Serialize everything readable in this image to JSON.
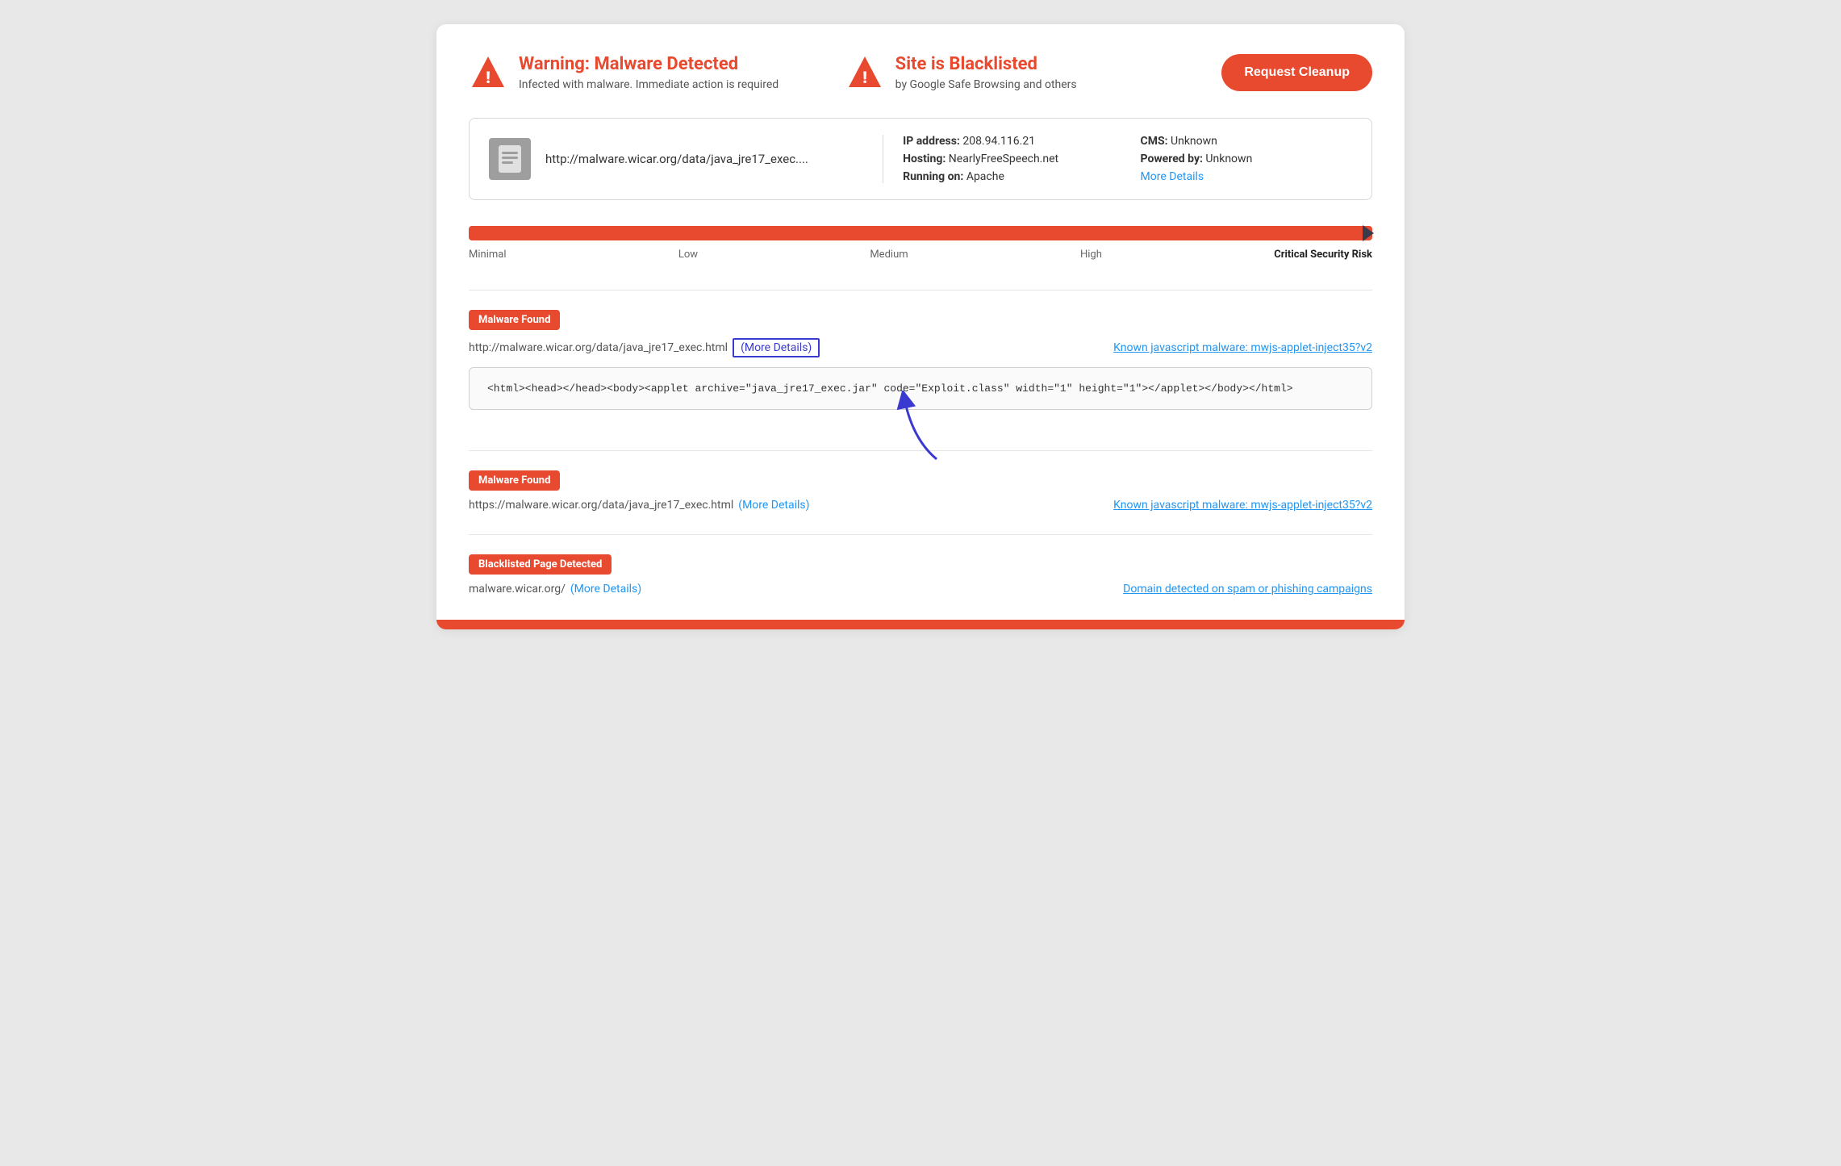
{
  "header": {
    "warning1": {
      "title": "Warning: Malware Detected",
      "subtitle": "Infected with malware. Immediate action is required"
    },
    "warning2": {
      "title": "Site is Blacklisted",
      "subtitle": "by Google Safe Browsing and others"
    },
    "cleanup_button": "Request Cleanup"
  },
  "site_info": {
    "url": "http://malware.wicar.org/data/java_jre17_exec....",
    "ip_label": "IP address:",
    "ip_value": "208.94.116.21",
    "hosting_label": "Hosting:",
    "hosting_value": "NearlyFreeSpeech.net",
    "running_label": "Running on:",
    "running_value": "Apache",
    "cms_label": "CMS:",
    "cms_value": "Unknown",
    "powered_label": "Powered by:",
    "powered_value": "Unknown",
    "more_details": "More Details"
  },
  "risk_bar": {
    "labels": [
      "Minimal",
      "Low",
      "Medium",
      "High",
      "Critical Security Risk"
    ]
  },
  "malware_entries": [
    {
      "badge": "Malware Found",
      "url": "http://malware.wicar.org/data/java_jre17_exec.html",
      "more_details_text": "(More Details)",
      "known_malware_text": "Known javascript malware: mwjs-applet-inject35?v2",
      "code": "<html><head></head><body><applet archive=\"java_jre17_exec.jar\" code=\"Exploit.class\" width=\"1\" height=\"1\"></applet></body></html>",
      "has_arrow": true
    },
    {
      "badge": "Malware Found",
      "url": "https://malware.wicar.org/data/java_jre17_exec.html",
      "more_details_text": "(More Details)",
      "known_malware_text": "Known javascript malware: mwjs-applet-inject35?v2",
      "code": null,
      "has_arrow": false
    }
  ],
  "blacklisted_entry": {
    "badge": "Blacklisted Page Detected",
    "url": "malware.wicar.org/",
    "more_details_text": "(More Details)",
    "domain_link": "Domain detected on spam or phishing campaigns"
  }
}
